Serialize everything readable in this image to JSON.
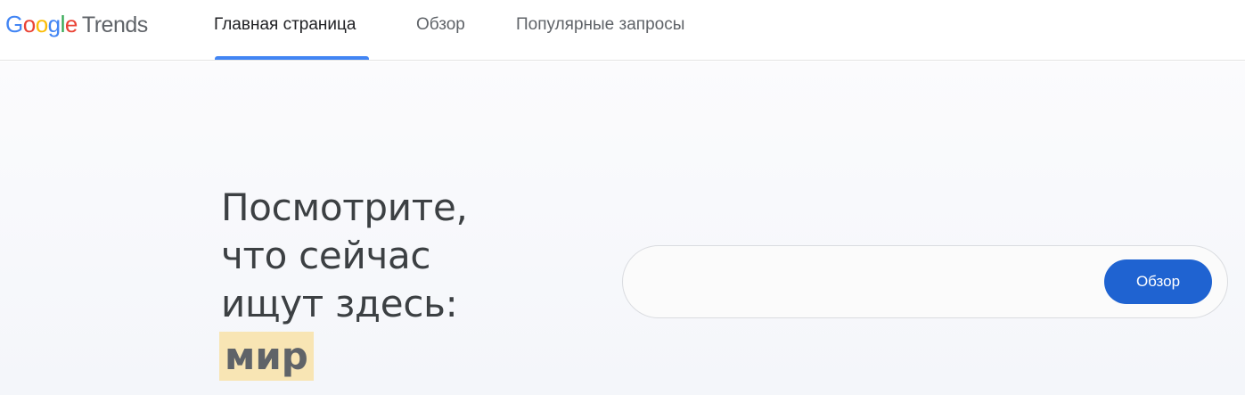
{
  "header": {
    "logo": {
      "google_letters": [
        "G",
        "o",
        "o",
        "g",
        "l",
        "e"
      ],
      "product": "Trends"
    },
    "tabs": [
      {
        "label": "Главная страница",
        "active": true
      },
      {
        "label": "Обзор",
        "active": false
      },
      {
        "label": "Популярные запросы",
        "active": false
      }
    ]
  },
  "hero": {
    "headline_lines": [
      "Посмотрите,",
      "что сейчас",
      "ищут здесь:"
    ],
    "highlight_word": "мир"
  },
  "search": {
    "value": "",
    "placeholder": "",
    "button_label": "Обзор"
  },
  "colors": {
    "accent": "#4285F4",
    "button": "#1f63d1",
    "highlight": "#f8e5b4"
  }
}
